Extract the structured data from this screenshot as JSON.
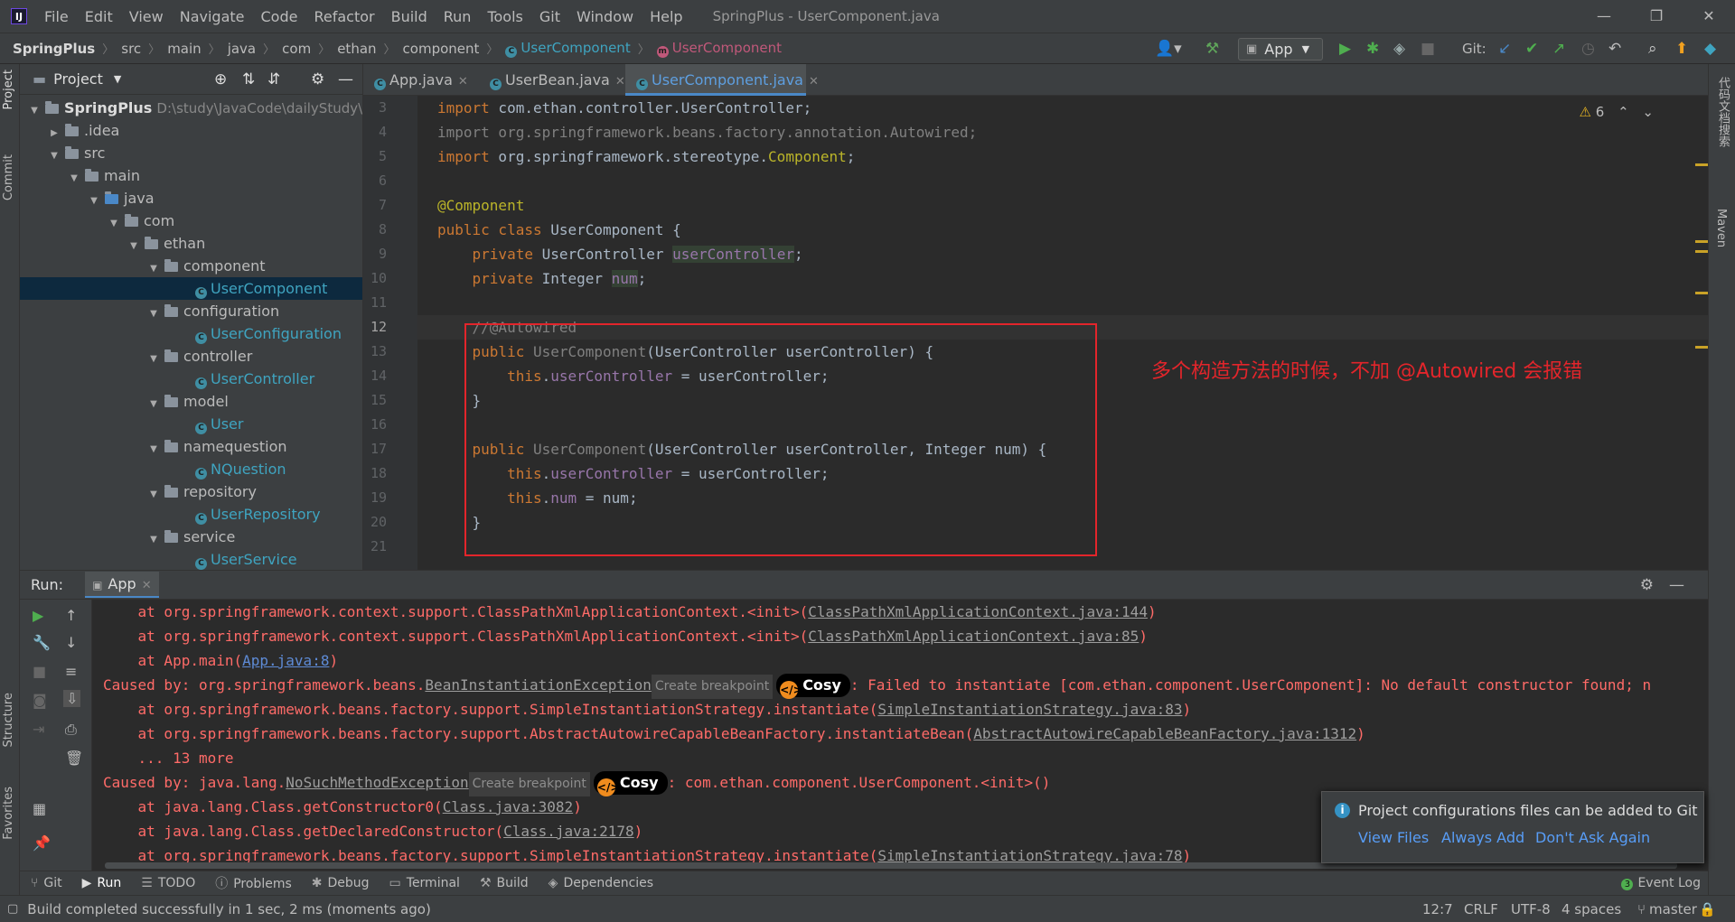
{
  "window": {
    "title": "SpringPlus - UserComponent.java",
    "logo": "IJ",
    "min": "—",
    "max": "❐",
    "close": "✕"
  },
  "menu": [
    "File",
    "Edit",
    "View",
    "Navigate",
    "Code",
    "Refactor",
    "Build",
    "Run",
    "Tools",
    "Git",
    "Window",
    "Help"
  ],
  "breadcrumb": [
    "SpringPlus",
    "src",
    "main",
    "java",
    "com",
    "ethan",
    "component",
    "UserComponent",
    "UserComponent"
  ],
  "toolbar": {
    "run_config": "App",
    "git_label": "Git:"
  },
  "project": {
    "title": "Project",
    "root_name": "SpringPlus",
    "root_path": "D:\\study\\JavaCode\\dailyStudy\\S",
    "items": [
      ".idea",
      "src",
      "main",
      "java",
      "com",
      "ethan",
      "component",
      "UserComponent",
      "configuration",
      "UserConfiguration",
      "controller",
      "UserController",
      "model",
      "User",
      "namequestion",
      "NQuestion",
      "repository",
      "UserRepository",
      "service",
      "UserService"
    ]
  },
  "editor": {
    "tabs": [
      "App.java",
      "UserBean.java",
      "UserComponent.java"
    ],
    "warnings": "6",
    "line_numbers": [
      "3",
      "4",
      "5",
      "6",
      "7",
      "8",
      "9",
      "10",
      "11",
      "12",
      "13",
      "14",
      "15",
      "16",
      "17",
      "18",
      "19",
      "20",
      "21"
    ],
    "annotation_note": "多个构造方法的时候，不加 @Autowired 会报错"
  },
  "run": {
    "label": "Run:",
    "tab": "App",
    "lines": [
      {
        "pre": "    at org.springframework.context.support.ClassPathXmlApplicationContext.<init>(",
        "link": "ClassPathXmlApplicationContext.java:144",
        "post": ")"
      },
      {
        "pre": "    at org.springframework.context.support.ClassPathXmlApplicationContext.<init>(",
        "link": "ClassPathXmlApplicationContext.java:85",
        "post": ")"
      },
      {
        "pre": "    at App.main(",
        "link": "App.java:8",
        "post": ")"
      },
      {
        "pre": "Caused by: org.springframework.beans.",
        "link": "BeanInstantiationException",
        "post": ": Failed to instantiate [com.ethan.component.UserComponent]: No default constructor found; n"
      },
      {
        "pre": "    at org.springframework.beans.factory.support.SimpleInstantiationStrategy.instantiate(",
        "link": "SimpleInstantiationStrategy.java:83",
        "post": ")"
      },
      {
        "pre": "    at org.springframework.beans.factory.support.AbstractAutowireCapableBeanFactory.instantiateBean(",
        "link": "AbstractAutowireCapableBeanFactory.java:1312",
        "post": ")"
      },
      {
        "pre": "    ... 13 more",
        "link": "",
        "post": ""
      },
      {
        "pre": "Caused by: java.lang.",
        "link": "NoSuchMethodException",
        "post": ": com.ethan.component.UserComponent.<init>()"
      },
      {
        "pre": "    at java.lang.Class.getConstructor0(",
        "link": "Class.java:3082",
        "post": ")"
      },
      {
        "pre": "    at java.lang.Class.getDeclaredConstructor(",
        "link": "Class.java:2178",
        "post": ")"
      },
      {
        "pre": "    at org.springframework.beans.factory.support.SimpleInstantiationStrategy.instantiate(",
        "link": "SimpleInstantiationStrategy.java:78",
        "post": ")"
      }
    ],
    "create_breakpoint": "Create breakpoint",
    "cosy": "Cosy"
  },
  "notification": {
    "text": "Project configurations files can be added to Git",
    "actions": [
      "View Files",
      "Always Add",
      "Don't Ask Again"
    ]
  },
  "bottom_tabs": [
    "Git",
    "Run",
    "TODO",
    "Problems",
    "Debug",
    "Terminal",
    "Build",
    "Dependencies"
  ],
  "event_log": {
    "count": "3",
    "label": "Event Log"
  },
  "left_tabs": [
    "Project",
    "Commit",
    "Structure",
    "Favorites"
  ],
  "right_tabs": [
    "代码文档搜索",
    "Maven"
  ],
  "status": {
    "message": "Build completed successfully in 1 sec, 2 ms (moments ago)",
    "position": "12:7",
    "line_sep": "CRLF",
    "encoding": "UTF-8",
    "indent": "4 spaces",
    "branch": "master"
  }
}
